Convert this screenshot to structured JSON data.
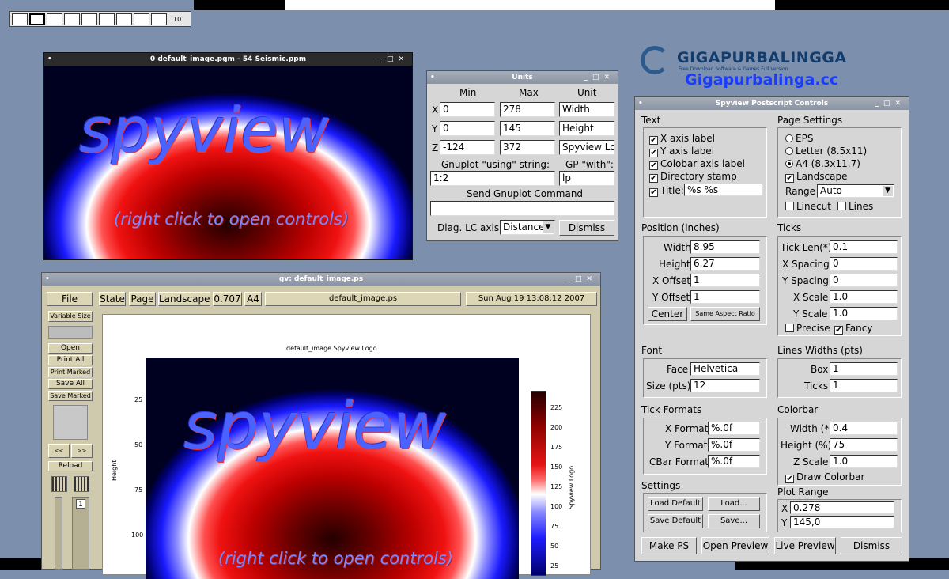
{
  "desktop": {
    "pager_desktop_label": "10"
  },
  "watermark": {
    "brand": "GIGAPURBALINGGA",
    "tagline": "Free Download Software & Games Full Version",
    "site": "Gigapurbalinga.cc"
  },
  "image_window": {
    "title": "0 default_image.pgm - 54 Seismic.ppm",
    "logo_text": "spyview",
    "hint_text": "(right click to open controls)"
  },
  "units_window": {
    "title": "Units",
    "headers": {
      "min": "Min",
      "max": "Max",
      "unit": "Unit"
    },
    "rows": [
      {
        "axis": "X",
        "min": "0",
        "max": "278",
        "unit": "Width"
      },
      {
        "axis": "Y",
        "min": "0",
        "max": "145",
        "unit": "Height"
      },
      {
        "axis": "Z",
        "min": "-124",
        "max": "372",
        "unit": "Spyview Logo"
      }
    ],
    "using_label": "Gnuplot \"using\" string:",
    "using_value": "1:2",
    "with_label": "GP \"with\":",
    "with_value": "lp",
    "send_label": "Send Gnuplot Command",
    "send_value": "",
    "diag_label": "Diag. LC axis:",
    "diag_value": "Distance",
    "dismiss_label": "Dismiss"
  },
  "gv_window": {
    "title": "gv: default_image.ps",
    "file_button": "File",
    "state_button": "State",
    "page_button": "Page",
    "orientation": "Landscape",
    "scale": "0.707",
    "media": "A4",
    "filename": "default_image.ps",
    "date": "Sun Aug 19 13:08:12 2007",
    "side_buttons": [
      "Open",
      "Print All",
      "Print Marked",
      "Save All",
      "Save Marked"
    ],
    "variable_size": "Variable Size",
    "prev_label": "<<",
    "next_label": ">>",
    "reload_label": "Reload",
    "page_number": "1",
    "plot": {
      "title": "default_image Spyview Logo",
      "ylabel": "Height",
      "yticks": [
        "25",
        "50",
        "75",
        "100"
      ],
      "colorbar_label": "Spyview Logo",
      "colorbar_ticks": [
        "225",
        "200",
        "175",
        "150",
        "125",
        "100",
        "75",
        "50",
        "25"
      ],
      "logo_text": "spyview",
      "hint_text": "(right click to open controls)"
    }
  },
  "ps_window": {
    "title": "Spyview Postscript Controls",
    "text_section": {
      "label": "Text",
      "x_axis_label": "X axis label",
      "y_axis_label": "Y axis label",
      "colorbar_axis_label": "Colobar axis label",
      "directory_stamp": "Directory stamp",
      "title_label": "Title:",
      "title_value": "%s %s"
    },
    "page_settings": {
      "label": "Page Settings",
      "eps": "EPS",
      "letter": "Letter (8.5x11)",
      "a4": "A4 (8.3x11.7)",
      "landscape": "Landscape",
      "range_label": "Range",
      "range_value": "Auto",
      "linecut": "Linecut",
      "lines": "Lines"
    },
    "position": {
      "label": "Position (inches)",
      "width_label": "Width",
      "width_value": "8.95",
      "height_label": "Height",
      "height_value": "6.27",
      "xoffset_label": "X Offset",
      "xoffset_value": "1",
      "yoffset_label": "Y Offset",
      "yoffset_value": "1",
      "center_button": "Center",
      "aspect_button": "Same Aspect Ratio"
    },
    "ticks": {
      "label": "Ticks",
      "ticklen_label": "Tick Len(*)",
      "ticklen_value": "0.1",
      "xspacing_label": "X Spacing",
      "xspacing_value": "0",
      "yspacing_label": "Y Spacing",
      "yspacing_value": "0",
      "xscale_label": "X Scale",
      "xscale_value": "1.0",
      "yscale_label": "Y Scale",
      "yscale_value": "1.0",
      "precise": "Precise",
      "fancy": "Fancy"
    },
    "font": {
      "label": "Font",
      "face_label": "Face",
      "face_value": "Helvetica",
      "size_label": "Size (pts)",
      "size_value": "12"
    },
    "line_widths": {
      "label": "Lines Widths (pts)",
      "box_label": "Box",
      "box_value": "1",
      "ticks_label": "Ticks",
      "ticks_value": "1"
    },
    "tick_formats": {
      "label": "Tick Formats",
      "x_label": "X Format",
      "x_value": "%.0f",
      "y_label": "Y Format",
      "y_value": "%.0f",
      "cbar_label": "CBar Format",
      "cbar_value": "%.0f"
    },
    "colorbar": {
      "label": "Colorbar",
      "width_label": "Width (*)",
      "width_value": "0.4",
      "height_label": "Height (%)",
      "height_value": "75",
      "zscale_label": "Z Scale",
      "zscale_value": "1.0",
      "draw_label": "Draw Colorbar"
    },
    "settings": {
      "label": "Settings",
      "load_default": "Load Default",
      "load": "Load...",
      "save_default": "Save Default",
      "save": "Save..."
    },
    "plot_range": {
      "label": "Plot Range",
      "x_label": "X",
      "x_value": "0.278",
      "y_label": "Y",
      "y_value": "145,0"
    },
    "bottom_buttons": {
      "make_ps": "Make PS",
      "open_preview": "Open Preview",
      "live_preview": "Live Preview",
      "dismiss": "Dismiss"
    }
  }
}
